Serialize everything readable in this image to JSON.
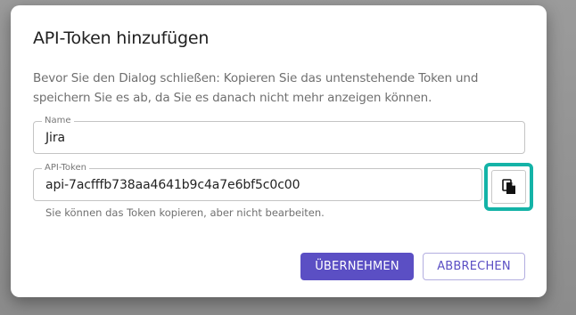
{
  "dialog": {
    "title": "API-Token hinzufügen",
    "description": "Bevor Sie den Dialog schließen: Kopieren Sie das untenstehende Token und speichern Sie es ab, da Sie es danach nicht mehr anzeigen können.",
    "name_field": {
      "label": "Name",
      "value": "Jira"
    },
    "token_field": {
      "label": "API-Token",
      "value": "api-7acfffb738aa4641b9c4a7e6bf5c0c00"
    },
    "helper_text": "Sie können das Token kopieren, aber nicht bearbeiten.",
    "copy_icon": "copy-icon",
    "buttons": {
      "confirm": "ÜBERNEHMEN",
      "cancel": "ABBRECHEN"
    }
  },
  "colors": {
    "primary": "#5b4fc4",
    "highlight": "#14b3a7",
    "backdrop": "#8f8f8f"
  }
}
